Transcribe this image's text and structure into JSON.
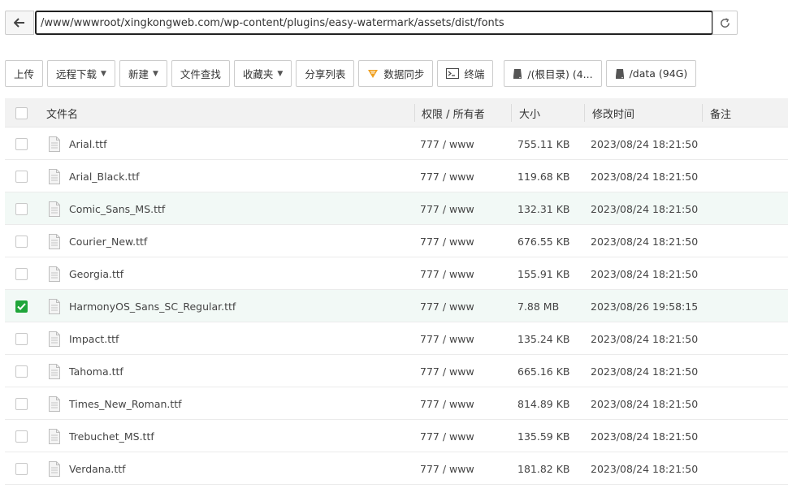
{
  "path_bar": {
    "current_path": "/www/wwwroot/xingkongweb.com/wp-content/plugins/easy-watermark/assets/dist/fonts"
  },
  "toolbar": {
    "upload": "上传",
    "remote_download": "远程下载",
    "new": "新建",
    "file_search": "文件查找",
    "favorites": "收藏夹",
    "share_list": "分享列表",
    "sync_data": "数据同步",
    "terminal": "终端",
    "disk_root": "/(根目录) (4...",
    "disk_data": "/data (94G)"
  },
  "table": {
    "headers": {
      "name": "文件名",
      "perm_owner": "权限 / 所有者",
      "size": "大小",
      "modified": "修改时间",
      "remark": "备注"
    },
    "rows": [
      {
        "name": "Arial.ttf",
        "perm": "777 / www",
        "size": "755.11 KB",
        "modified": "2023/08/24 18:21:50",
        "checked": false
      },
      {
        "name": "Arial_Black.ttf",
        "perm": "777 / www",
        "size": "119.68 KB",
        "modified": "2023/08/24 18:21:50",
        "checked": false
      },
      {
        "name": "Comic_Sans_MS.ttf",
        "perm": "777 / www",
        "size": "132.31 KB",
        "modified": "2023/08/24 18:21:50",
        "checked": false
      },
      {
        "name": "Courier_New.ttf",
        "perm": "777 / www",
        "size": "676.55 KB",
        "modified": "2023/08/24 18:21:50",
        "checked": false
      },
      {
        "name": "Georgia.ttf",
        "perm": "777 / www",
        "size": "155.91 KB",
        "modified": "2023/08/24 18:21:50",
        "checked": false
      },
      {
        "name": "HarmonyOS_Sans_SC_Regular.ttf",
        "perm": "777 / www",
        "size": "7.88 MB",
        "modified": "2023/08/26 19:58:15",
        "checked": true
      },
      {
        "name": "Impact.ttf",
        "perm": "777 / www",
        "size": "135.24 KB",
        "modified": "2023/08/24 18:21:50",
        "checked": false
      },
      {
        "name": "Tahoma.ttf",
        "perm": "777 / www",
        "size": "665.16 KB",
        "modified": "2023/08/24 18:21:50",
        "checked": false
      },
      {
        "name": "Times_New_Roman.ttf",
        "perm": "777 / www",
        "size": "814.89 KB",
        "modified": "2023/08/24 18:21:50",
        "checked": false
      },
      {
        "name": "Trebuchet_MS.ttf",
        "perm": "777 / www",
        "size": "135.59 KB",
        "modified": "2023/08/24 18:21:50",
        "checked": false
      },
      {
        "name": "Verdana.ttf",
        "perm": "777 / www",
        "size": "181.82 KB",
        "modified": "2023/08/24 18:21:50",
        "checked": false
      }
    ]
  },
  "colors": {
    "accent_green": "#20a53a",
    "row_highlight": "#f2f9f6",
    "header_bg": "#f2f2f2",
    "sync_icon": "#f0a020"
  }
}
